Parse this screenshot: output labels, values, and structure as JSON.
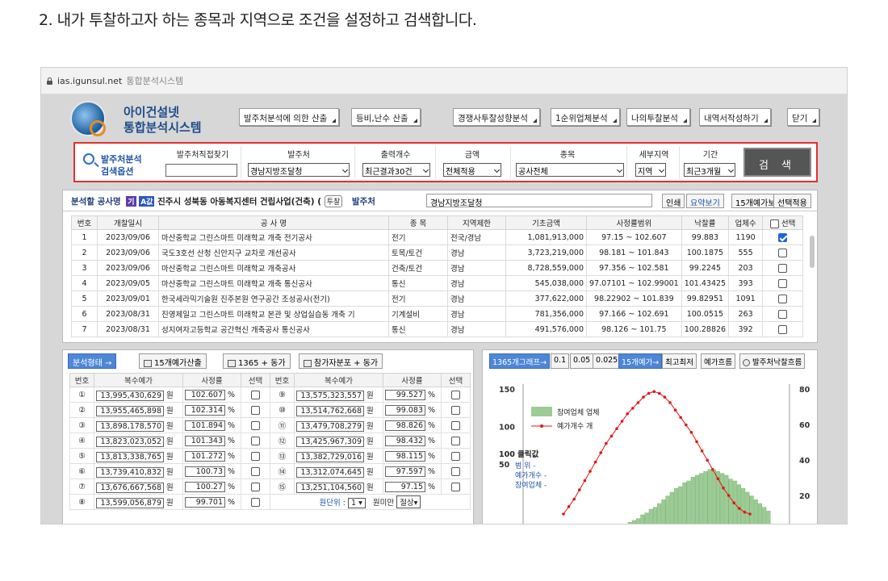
{
  "heading": "2. 내가 투찰하고자 하는 종목과 지역으로 조건을 설정하고 검색합니다.",
  "browser": {
    "url": "ias.igunsul.net",
    "page_title": "통합분석시스템"
  },
  "logo": {
    "line1": "아이건설넷",
    "line2": "통합분석시스템"
  },
  "toolbar": [
    {
      "label": "발주처분석에 의한 산출"
    },
    {
      "label": "등비,난수 산출"
    },
    {
      "label": "경쟁사투찰성향분석"
    },
    {
      "label": "1순위업체분석"
    },
    {
      "label": "나의투찰분석"
    },
    {
      "label": "내역서작성하기"
    },
    {
      "label": "닫기"
    }
  ],
  "search": {
    "title1": "발주처분석",
    "title2": "검색옵션",
    "headers": [
      "발주처직접찾기",
      "발주처",
      "출력개수",
      "금액",
      "종목",
      "세부지역",
      "기간"
    ],
    "direct_value": "",
    "agency": "경남지방조달청",
    "output_count": "최근결과30건",
    "amount": "전체적용",
    "item": "공사전체",
    "region": "지역",
    "period": "최근3개월",
    "button": "검 색"
  },
  "results": {
    "label": "분석할 공사명",
    "tag1": "기",
    "tag2": "A값",
    "project": "진주시 성북동 아동복지센터 건립사업(건축) (",
    "pill": "투찰",
    "agency_label": "발주처",
    "agency_value": "경남지방조달청",
    "buttons": [
      "인쇄",
      "요약보기",
      "15개예가보기",
      "선택적용"
    ],
    "columns": [
      "번호",
      "개찰일시",
      "공 사 명",
      "종 목",
      "지역제한",
      "기초금액",
      "사정률범위",
      "낙찰률",
      "업체수",
      "선택"
    ],
    "rows": [
      [
        "1",
        "2023/09/06",
        "마산중학교 그린스마트 미래학교 개축 전기공사",
        "전기",
        "전국/경남",
        "1,081,913,000",
        "97.15 ~ 102.607",
        "99.883",
        "1190",
        true
      ],
      [
        "2",
        "2023/09/06",
        "국도3호선 산청 신안지구 교차로 개선공사",
        "토목/토건",
        "경남",
        "3,723,219,000",
        "98.181 ~ 101.843",
        "100.1875",
        "555",
        false
      ],
      [
        "3",
        "2023/09/06",
        "마산중학교 그린스마트 미래학교 개축공사",
        "건축/토건",
        "경남",
        "8,728,559,000",
        "97.356 ~ 102.581",
        "99.2245",
        "203",
        false
      ],
      [
        "4",
        "2023/09/05",
        "마산중학교 그린스마트 미래학교 개축 통신공사",
        "통신",
        "경남",
        "545,038,000",
        "97.07101 ~ 102.99001",
        "101.43425",
        "393",
        false
      ],
      [
        "5",
        "2023/09/01",
        "한국세라믹기술원 진주본원 연구공간 조성공사(전기)",
        "전기",
        "경남",
        "377,622,000",
        "98.22902 ~ 101.839",
        "99.82951",
        "1091",
        false
      ],
      [
        "6",
        "2023/08/31",
        "진영제일고 그린스마트 미래학교 본관 및 상업실습동 개축 기",
        "기계설비",
        "경남",
        "781,356,000",
        "97.166 ~ 102.691",
        "100.0515",
        "263",
        false
      ],
      [
        "7",
        "2023/08/31",
        "성지여자고등학교 공간혁신 개축공사 통신공사",
        "통신",
        "경남",
        "491,576,000",
        "98.126 ~ 101.75",
        "100.28826",
        "392",
        false
      ]
    ]
  },
  "analysis": {
    "mode_button": "분석형태 →",
    "buttons": [
      "15개예가산출",
      "1365 + 동가",
      "참가자분포 + 동가"
    ],
    "columns": [
      "번호",
      "복수예가",
      "사정률",
      "선택",
      "번호",
      "복수예가",
      "사정률",
      "선택"
    ],
    "unit_won": "원",
    "unit_pct": "%",
    "left": [
      {
        "no": "①",
        "price": "13,995,430,629",
        "rate": "102.607"
      },
      {
        "no": "②",
        "price": "13,955,465,898",
        "rate": "102.314"
      },
      {
        "no": "③",
        "price": "13,898,178,570",
        "rate": "101.894"
      },
      {
        "no": "④",
        "price": "13,823,023,052",
        "rate": "101.343"
      },
      {
        "no": "⑤",
        "price": "13,813,338,765",
        "rate": "101.272"
      },
      {
        "no": "⑥",
        "price": "13,739,410,832",
        "rate": "100.73"
      },
      {
        "no": "⑦",
        "price": "13,676,667,568",
        "rate": "100.27"
      },
      {
        "no": "⑧",
        "price": "13,599,056,879",
        "rate": "99.701"
      }
    ],
    "right": [
      {
        "no": "⑨",
        "price": "13,575,323,557",
        "rate": "99.527"
      },
      {
        "no": "⑩",
        "price": "13,514,762,668",
        "rate": "99.083"
      },
      {
        "no": "⑪",
        "price": "13,479,708,279",
        "rate": "98.826"
      },
      {
        "no": "⑫",
        "price": "13,425,967,309",
        "rate": "98.432"
      },
      {
        "no": "⑬",
        "price": "13,382,729,016",
        "rate": "98.115"
      },
      {
        "no": "⑭",
        "price": "13,312,074,645",
        "rate": "97.597"
      },
      {
        "no": "⑮",
        "price": "13,251,104,560",
        "rate": "97.15"
      }
    ],
    "unit_label": "원단위 :",
    "unit_value": "1",
    "below_label": "원미만",
    "below_value": "절상"
  },
  "chart_panel": {
    "buttons": [
      "1365개그래프→",
      "0.1",
      "0.05",
      "0.025",
      "15개예가→",
      "최고최저",
      "예가흐름",
      "발주처낙찰흐름"
    ]
  },
  "chart_data": {
    "type": "bar",
    "left_axis_ticks": [
      150,
      100,
      50
    ],
    "right_axis_ticks": [
      80,
      60,
      40,
      20
    ],
    "legend": [
      {
        "name": "참여업체 업체",
        "color": "#9ccc95"
      },
      {
        "name": "예가개수 개",
        "color": "#e01818"
      }
    ],
    "info_title": "100 클릭값",
    "info_lines": [
      "범 위 -",
      "예가개수 -",
      "참여업체 -"
    ],
    "bars": [
      2,
      3,
      4,
      6,
      7,
      9,
      10,
      12,
      14,
      16,
      18,
      20,
      21,
      23,
      24,
      26,
      27,
      28,
      29,
      30,
      30,
      29,
      28,
      27,
      25,
      24,
      22,
      20,
      18,
      16,
      14,
      12,
      10,
      8
    ],
    "line": [
      20,
      28,
      36,
      46,
      56,
      66,
      76,
      86,
      96,
      104,
      112,
      120,
      128,
      134,
      140,
      146,
      150,
      152,
      150,
      146,
      140,
      132,
      124,
      116,
      108,
      98,
      88,
      78,
      68,
      58,
      48,
      40,
      32,
      26,
      22,
      20
    ]
  }
}
